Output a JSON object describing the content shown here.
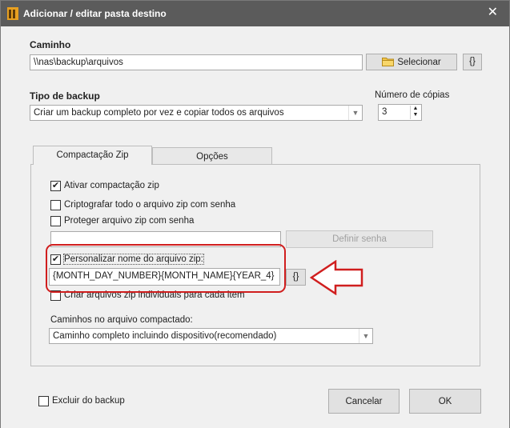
{
  "window": {
    "title": "Adicionar / editar pasta destino",
    "close_glyph": "✕"
  },
  "path": {
    "label": "Caminho",
    "value": "\\\\nas\\backup\\arquivos",
    "select_button": "Selecionar",
    "vars_button": "{}"
  },
  "backup_type": {
    "label": "Tipo de backup",
    "value": "Criar um backup completo por vez e copiar todos os arquivos",
    "copies_label": "Número de cópias",
    "copies_value": "3"
  },
  "tabs": [
    {
      "label": "Compactação Zip",
      "active": true
    },
    {
      "label": "Opções",
      "active": false
    }
  ],
  "zip": {
    "enable_label": "Ativar compactação zip",
    "enable_checked": true,
    "encrypt_label": "Criptografar todo o arquivo zip com senha",
    "encrypt_checked": false,
    "protect_label": "Proteger arquivo zip com senha",
    "protect_checked": false,
    "password_value": "",
    "set_password_button": "Definir senha",
    "custom_name_label": "Personalizar nome do arquivo zip:",
    "custom_name_checked": true,
    "custom_name_value": "{MONTH_DAY_NUMBER}{MONTH_NAME}{YEAR_4}",
    "custom_name_vars_button": "{}",
    "individual_label": "Criar arquivos zip individuais para cada item",
    "individual_checked": false,
    "paths_label": "Caminhos no arquivo compactado:",
    "paths_value": "Caminho completo incluindo dispositivo(recomendado)"
  },
  "footer": {
    "exclude_label": "Excluir do backup",
    "exclude_checked": false,
    "cancel_button": "Cancelar",
    "ok_button": "OK"
  },
  "colors": {
    "titlebar": "#5b5b5b",
    "annotation": "#d01e1e",
    "background": "#f0f0f0"
  }
}
